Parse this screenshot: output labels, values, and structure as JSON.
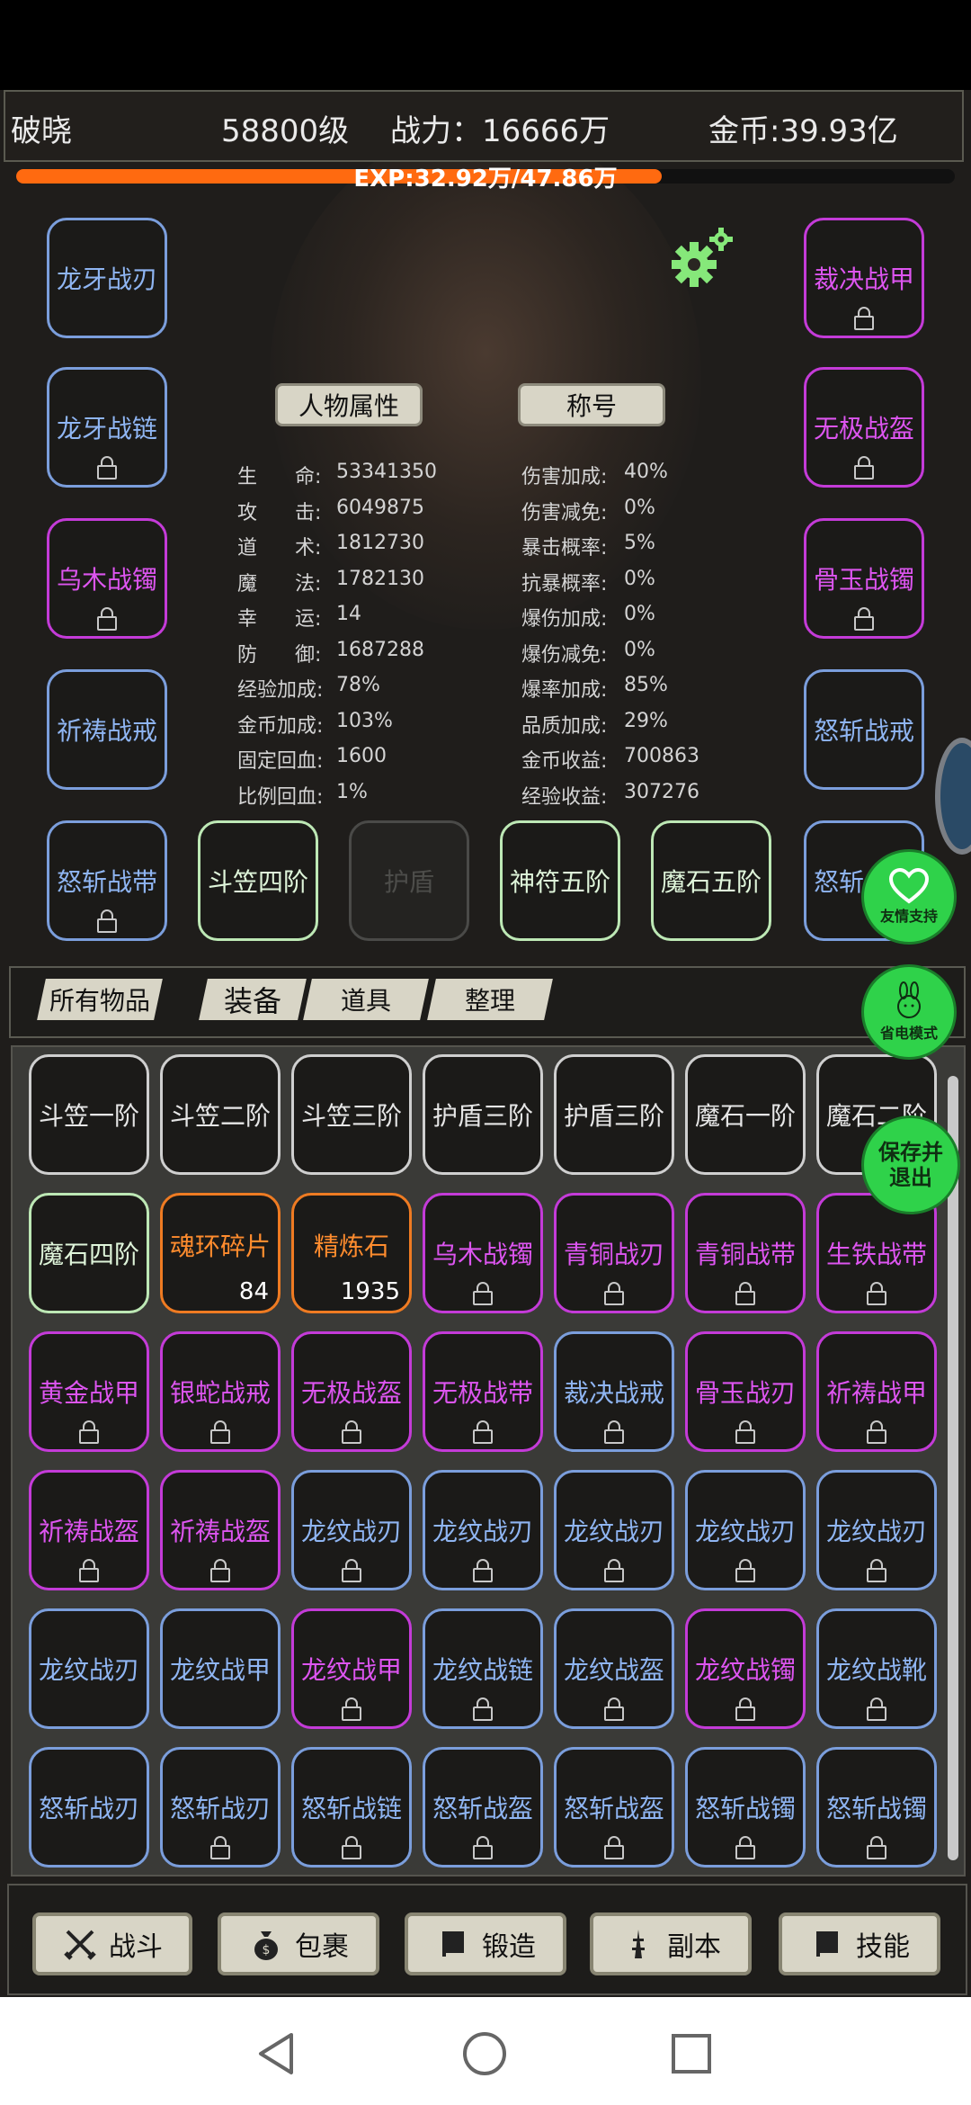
{
  "header": {
    "player_name": "破晓",
    "level": "58800级",
    "combat_power": "战力：16666万",
    "gold": "金币:39.93亿"
  },
  "exp": {
    "text": "EXP:32.92万/47.86万",
    "progress": 0.688
  },
  "left_equipment": [
    {
      "label": "龙牙战刃",
      "rarity": "blue",
      "locked": false
    },
    {
      "label": "龙牙战链",
      "rarity": "blue",
      "locked": true
    },
    {
      "label": "乌木战镯",
      "rarity": "purple",
      "locked": true
    },
    {
      "label": "祈祷战戒",
      "rarity": "blue",
      "locked": false
    },
    {
      "label": "怒斩战带",
      "rarity": "blue",
      "locked": true
    }
  ],
  "right_equipment": [
    {
      "label": "裁决战甲",
      "rarity": "purple",
      "locked": true
    },
    {
      "label": "无极战盔",
      "rarity": "purple",
      "locked": true
    },
    {
      "label": "骨玉战镯",
      "rarity": "purple",
      "locked": true
    },
    {
      "label": "怒斩战戒",
      "rarity": "blue",
      "locked": false
    },
    {
      "label": "怒斩战靴",
      "rarity": "blue",
      "locked": false
    }
  ],
  "middle_equipment": [
    {
      "label": "斗笠四阶",
      "rarity": "green"
    },
    {
      "label": "护盾",
      "rarity": "gray"
    },
    {
      "label": "神符五阶",
      "rarity": "green"
    },
    {
      "label": "魔石五阶",
      "rarity": "green"
    }
  ],
  "character_buttons": {
    "attributes": "人物属性",
    "title": "称号"
  },
  "stats_left": [
    {
      "label": "生      命:",
      "value": "53341350"
    },
    {
      "label": "攻      击:",
      "value": "6049875"
    },
    {
      "label": "道      术:",
      "value": "1812730"
    },
    {
      "label": "魔      法:",
      "value": "1782130"
    },
    {
      "label": "幸      运:",
      "value": "14"
    },
    {
      "label": "防      御:",
      "value": "1687288"
    },
    {
      "label": "经验加成:",
      "value": "78%"
    },
    {
      "label": "金币加成:",
      "value": "103%"
    },
    {
      "label": "固定回血:",
      "value": "1600"
    },
    {
      "label": "比例回血:",
      "value": "1%"
    }
  ],
  "stats_right": [
    {
      "label": "伤害加成:",
      "value": "40%"
    },
    {
      "label": "伤害减免:",
      "value": "0%"
    },
    {
      "label": "暴击概率:",
      "value": "5%"
    },
    {
      "label": "抗暴概率:",
      "value": "0%"
    },
    {
      "label": "爆伤加成:",
      "value": "0%"
    },
    {
      "label": "爆伤减免:",
      "value": "0%"
    },
    {
      "label": "爆率加成:",
      "value": "85%"
    },
    {
      "label": "品质加成:",
      "value": "29%"
    },
    {
      "label": "金币收益:",
      "value": "700863"
    },
    {
      "label": "经验收益:",
      "value": "307276"
    }
  ],
  "inventory_tabs": {
    "all": "所有物品",
    "equipment": "装备",
    "items": "道具",
    "sort": "整理"
  },
  "inventory": [
    {
      "label": "斗笠一阶",
      "rarity": "white",
      "locked": false,
      "count": ""
    },
    {
      "label": "斗笠二阶",
      "rarity": "white",
      "locked": false,
      "count": ""
    },
    {
      "label": "斗笠三阶",
      "rarity": "white",
      "locked": false,
      "count": ""
    },
    {
      "label": "护盾三阶",
      "rarity": "white",
      "locked": false,
      "count": ""
    },
    {
      "label": "护盾三阶",
      "rarity": "white",
      "locked": false,
      "count": ""
    },
    {
      "label": "魔石一阶",
      "rarity": "white",
      "locked": false,
      "count": ""
    },
    {
      "label": "魔石二阶",
      "rarity": "white",
      "locked": false,
      "count": ""
    },
    {
      "label": "魔石四阶",
      "rarity": "green",
      "locked": false,
      "count": ""
    },
    {
      "label": "魂环碎片",
      "rarity": "orange",
      "locked": false,
      "count": "84"
    },
    {
      "label": "精炼石",
      "rarity": "orange",
      "locked": false,
      "count": "1935"
    },
    {
      "label": "乌木战镯",
      "rarity": "purple",
      "locked": true,
      "count": ""
    },
    {
      "label": "青铜战刃",
      "rarity": "purple",
      "locked": true,
      "count": ""
    },
    {
      "label": "青铜战带",
      "rarity": "purple",
      "locked": true,
      "count": ""
    },
    {
      "label": "生铁战带",
      "rarity": "purple",
      "locked": true,
      "count": ""
    },
    {
      "label": "黄金战甲",
      "rarity": "purple",
      "locked": true,
      "count": ""
    },
    {
      "label": "银蛇战戒",
      "rarity": "purple",
      "locked": true,
      "count": ""
    },
    {
      "label": "无极战盔",
      "rarity": "purple",
      "locked": true,
      "count": ""
    },
    {
      "label": "无极战带",
      "rarity": "purple",
      "locked": true,
      "count": ""
    },
    {
      "label": "裁决战戒",
      "rarity": "blue",
      "locked": true,
      "count": ""
    },
    {
      "label": "骨玉战刃",
      "rarity": "purple",
      "locked": true,
      "count": ""
    },
    {
      "label": "祈祷战甲",
      "rarity": "purple",
      "locked": true,
      "count": ""
    },
    {
      "label": "祈祷战盔",
      "rarity": "purple",
      "locked": true,
      "count": ""
    },
    {
      "label": "祈祷战盔",
      "rarity": "purple",
      "locked": true,
      "count": ""
    },
    {
      "label": "龙纹战刃",
      "rarity": "blue",
      "locked": true,
      "count": ""
    },
    {
      "label": "龙纹战刃",
      "rarity": "blue",
      "locked": true,
      "count": ""
    },
    {
      "label": "龙纹战刃",
      "rarity": "blue",
      "locked": true,
      "count": ""
    },
    {
      "label": "龙纹战刃",
      "rarity": "blue",
      "locked": true,
      "count": ""
    },
    {
      "label": "龙纹战刃",
      "rarity": "blue",
      "locked": true,
      "count": ""
    },
    {
      "label": "龙纹战刃",
      "rarity": "blue",
      "locked": false,
      "count": ""
    },
    {
      "label": "龙纹战甲",
      "rarity": "blue",
      "locked": false,
      "count": ""
    },
    {
      "label": "龙纹战甲",
      "rarity": "purple",
      "locked": true,
      "count": ""
    },
    {
      "label": "龙纹战链",
      "rarity": "blue",
      "locked": true,
      "count": ""
    },
    {
      "label": "龙纹战盔",
      "rarity": "blue",
      "locked": true,
      "count": ""
    },
    {
      "label": "龙纹战镯",
      "rarity": "purple",
      "locked": true,
      "count": ""
    },
    {
      "label": "龙纹战靴",
      "rarity": "blue",
      "locked": true,
      "count": ""
    },
    {
      "label": "怒斩战刃",
      "rarity": "blue",
      "locked": false,
      "count": ""
    },
    {
      "label": "怒斩战刃",
      "rarity": "blue",
      "locked": true,
      "count": ""
    },
    {
      "label": "怒斩战链",
      "rarity": "blue",
      "locked": true,
      "count": ""
    },
    {
      "label": "怒斩战盔",
      "rarity": "blue",
      "locked": true,
      "count": ""
    },
    {
      "label": "怒斩战盔",
      "rarity": "blue",
      "locked": true,
      "count": ""
    },
    {
      "label": "怒斩战镯",
      "rarity": "blue",
      "locked": true,
      "count": ""
    },
    {
      "label": "怒斩战镯",
      "rarity": "blue",
      "locked": true,
      "count": ""
    }
  ],
  "floating": {
    "support": "友情支持",
    "power_save": "省电模式",
    "save_exit": "保存并退出"
  },
  "bottom_nav": {
    "battle": "战斗",
    "bag": "包裹",
    "forge": "锻造",
    "dungeon": "副本",
    "skills": "技能"
  },
  "colors": {
    "blue": "#8fb5f2",
    "purple": "#dd55f0",
    "green": "#dff5da",
    "orange": "#ff8c2e",
    "exp_bar": "#ff6a10",
    "float_button": "#2fd24a"
  }
}
